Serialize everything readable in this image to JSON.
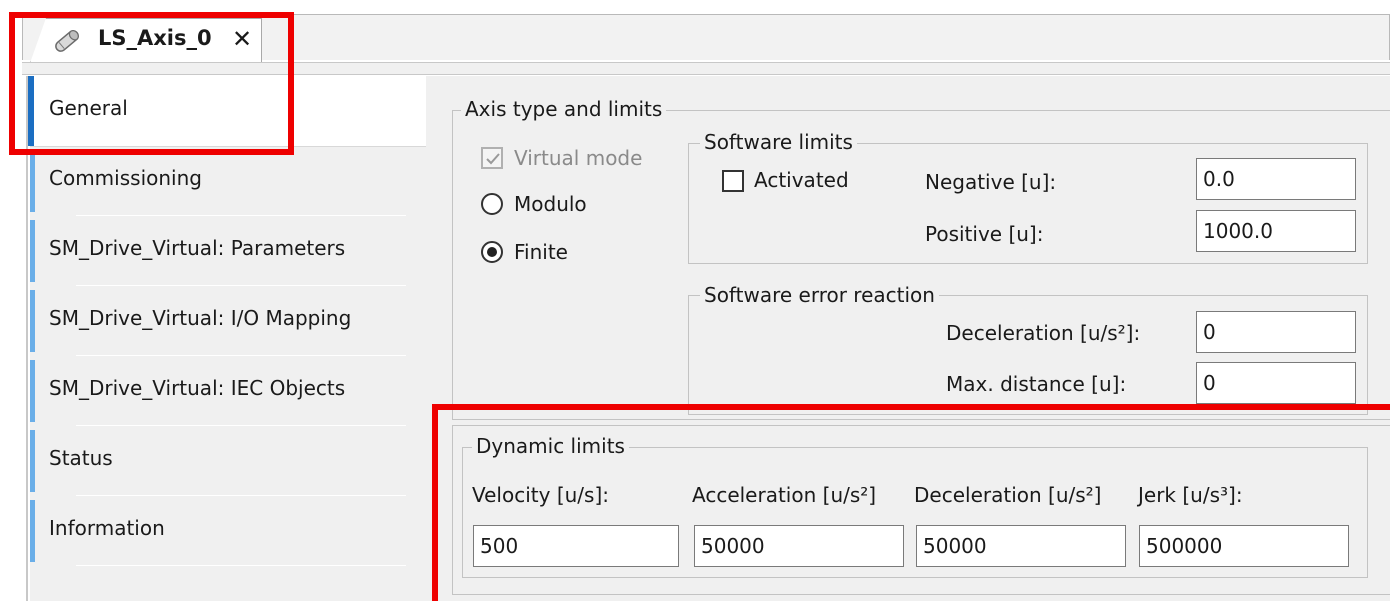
{
  "editor_tab": {
    "title": "LS_Axis_0",
    "close_glyph": "✕",
    "icon": "axis-icon"
  },
  "nav": {
    "items": [
      {
        "label": "General",
        "active": true
      },
      {
        "label": "Commissioning"
      },
      {
        "label": "SM_Drive_Virtual: Parameters"
      },
      {
        "label": "SM_Drive_Virtual: I/O Mapping"
      },
      {
        "label": "SM_Drive_Virtual: IEC Objects"
      },
      {
        "label": "Status"
      },
      {
        "label": "Information"
      }
    ]
  },
  "axis_type": {
    "title": "Axis type and limits",
    "virtual_mode": {
      "label": "Virtual mode",
      "checked": true,
      "disabled": true
    },
    "modulo": {
      "label": "Modulo",
      "selected": false
    },
    "finite": {
      "label": "Finite",
      "selected": true
    }
  },
  "software_limits": {
    "title": "Software limits",
    "activated": {
      "label": "Activated",
      "checked": false
    },
    "negative": {
      "label": "Negative [u]:",
      "value": "0.0"
    },
    "positive": {
      "label": "Positive [u]:",
      "value": "1000.0"
    }
  },
  "software_error_reaction": {
    "title": "Software error reaction",
    "deceleration": {
      "label": "Deceleration [u/s²]:",
      "value": "0"
    },
    "max_distance": {
      "label": "Max. distance [u]:",
      "value": "0"
    }
  },
  "dynamic_limits": {
    "title": "Dynamic limits",
    "velocity": {
      "label": "Velocity [u/s]:",
      "value": "500"
    },
    "acceleration": {
      "label": "Acceleration [u/s²]",
      "value": "50000"
    },
    "deceleration": {
      "label": "Deceleration [u/s²]",
      "value": "50000"
    },
    "jerk": {
      "label": "Jerk [u/s³]:",
      "value": "500000"
    }
  },
  "colors": {
    "highlight": "#ee0000",
    "nav_active_bar": "#1b6ec2",
    "nav_bar": "#6aaee8",
    "panel_bg": "#f0f0f0"
  }
}
